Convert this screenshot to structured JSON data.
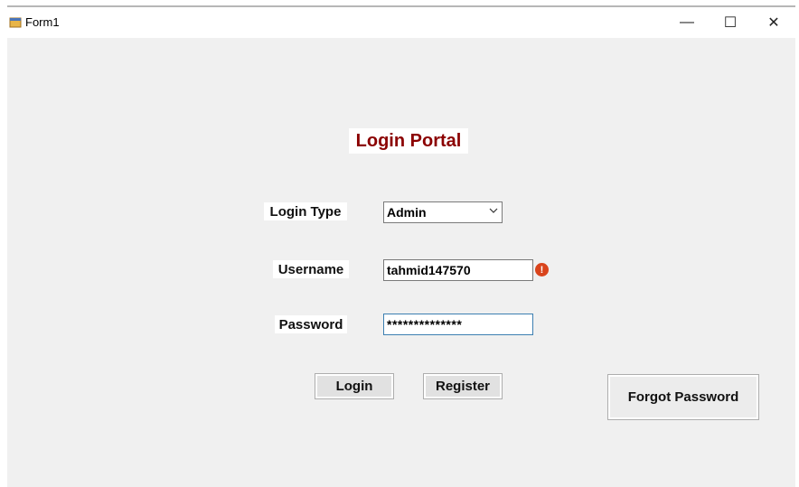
{
  "window": {
    "title": "Form1"
  },
  "caption": {
    "minimize": "—",
    "maximize": "☐",
    "close": "✕"
  },
  "portal": {
    "title": "Login Portal"
  },
  "form": {
    "login_type_label": "Login Type",
    "login_type_value": "Admin",
    "username_label": "Username",
    "username_value": "tahmid147570",
    "username_error_icon": "!",
    "password_label": "Password",
    "password_value": "**************"
  },
  "buttons": {
    "login": "Login",
    "register": "Register",
    "forgot": "Forgot Password"
  },
  "icons": {
    "app": "form-app-icon",
    "error": "error-icon",
    "dropdown": "chevron-down-icon"
  },
  "colors": {
    "title_text": "#8b0000",
    "error_icon": "#d9441c",
    "focus_border": "#3c7fb1"
  }
}
